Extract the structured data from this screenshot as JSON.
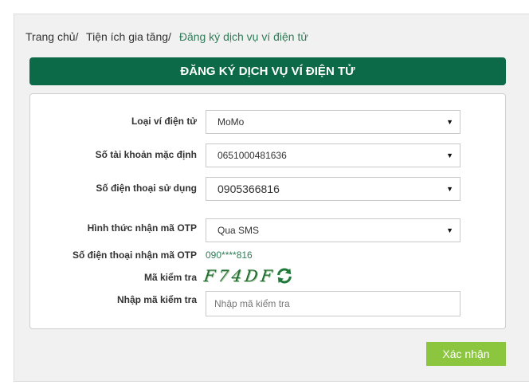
{
  "breadcrumb": {
    "home": "Trang chủ",
    "utilities": "Tiện ích gia tăng",
    "current": "Đăng ký dịch vụ ví điện tử",
    "separator": "/"
  },
  "form_title": "ĐĂNG KÝ DỊCH VỤ VÍ ĐIỆN TỬ",
  "fields": {
    "wallet_type": {
      "label": "Loại ví điện tử",
      "value": "MoMo"
    },
    "default_account": {
      "label": "Số tài khoản mặc định",
      "value": "0651000481636"
    },
    "phone_used": {
      "label": "Số điện thoại sử dụng",
      "value": "0905366816"
    },
    "otp_method": {
      "label": "Hình thức nhận mã OTP",
      "value": "Qua SMS"
    },
    "otp_phone": {
      "label": "Số điện thoại nhận mã OTP",
      "value": "090****816"
    },
    "captcha": {
      "label": "Mã kiểm tra",
      "value": "F74DF"
    },
    "captcha_input": {
      "label": "Nhập mã kiểm tra",
      "placeholder": "Nhập mã kiểm tra"
    }
  },
  "dropdown_caret": "▼",
  "submit_label": "Xác nhận",
  "colors": {
    "title_bar": "#0c6a48",
    "submit": "#8cc63f",
    "link_green": "#2f7d58"
  }
}
